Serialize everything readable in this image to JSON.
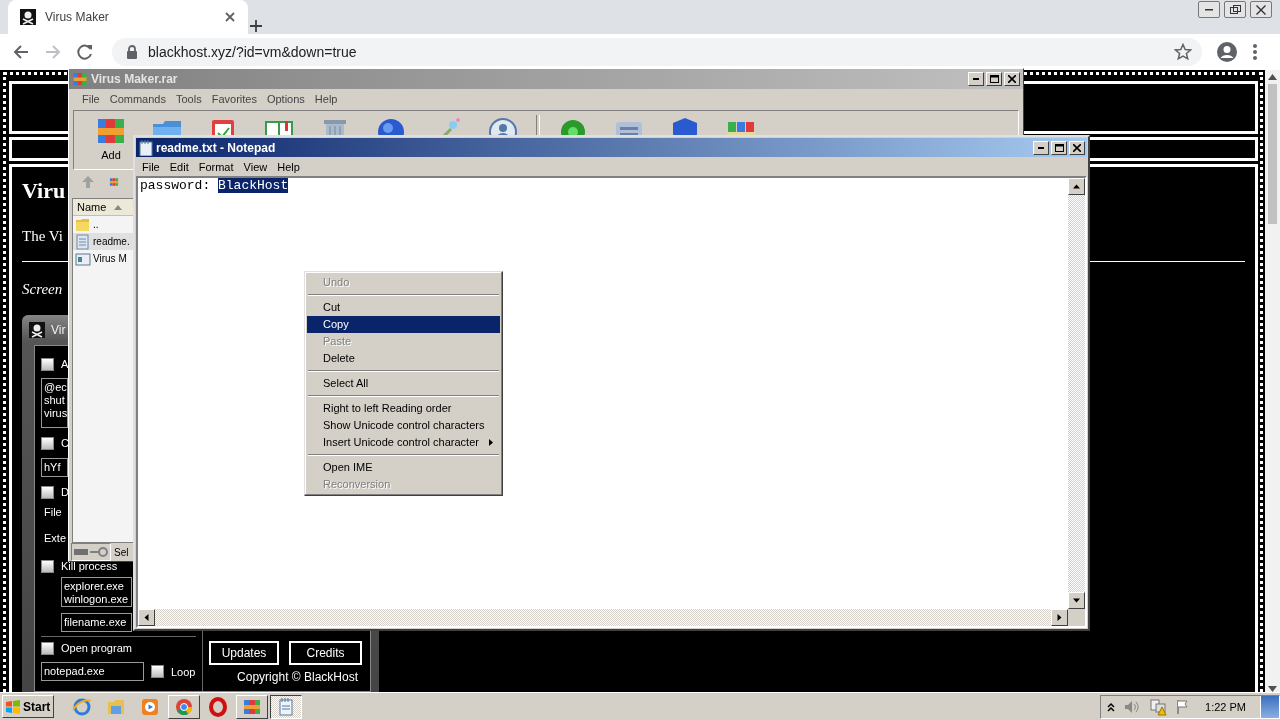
{
  "browser": {
    "tab": {
      "title": "Virus Maker",
      "selected": true
    },
    "address": "blackhost.xyz/?id=vm&down=true"
  },
  "page": {
    "heading": "Viru",
    "intro": "The Vi",
    "caption": "Screen",
    "app_preview": {
      "title": "Vir",
      "options": [
        {
          "kind": "checkbox",
          "label": "A",
          "checked": false
        },
        {
          "kind": "textarea",
          "lines": [
            "@ec",
            "shut",
            "virus"
          ],
          "indented": false
        },
        {
          "kind": "checkbox",
          "label": "C",
          "checked": false
        },
        {
          "kind": "field",
          "value": "hYf",
          "indented": false
        },
        {
          "kind": "checkbox",
          "label": "D",
          "checked": false
        },
        {
          "kind": "label",
          "text": "File"
        },
        {
          "kind": "label",
          "text": "Exte"
        },
        {
          "kind": "checkbox",
          "label": "Kill process",
          "checked": false
        },
        {
          "kind": "textarea",
          "lines": [
            "explorer.exe",
            "winlogon.exe"
          ],
          "indented": true
        },
        {
          "kind": "field",
          "value": "filename.exe",
          "indented": true
        },
        {
          "kind": "divider"
        },
        {
          "kind": "checkbox_with_field",
          "label": "Open program",
          "checked": false,
          "value": "notepad.exe",
          "loop": {
            "label": "Loop",
            "checked": false
          }
        }
      ],
      "buttons": [
        "Updates",
        "Credits"
      ],
      "copyright": "Copyright © BlackHost"
    }
  },
  "winrar": {
    "title": "Virus Maker.rar",
    "active": false,
    "menu": [
      "File",
      "Commands",
      "Tools",
      "Favorites",
      "Options",
      "Help"
    ],
    "toolbar": [
      {
        "kind": "books",
        "label": "Add"
      },
      {
        "kind": "folder"
      },
      {
        "kind": "clipboard"
      },
      {
        "kind": "book"
      },
      {
        "kind": "bin"
      },
      {
        "kind": "globe"
      },
      {
        "kind": "wand"
      },
      {
        "kind": "badge"
      },
      {
        "kind": "virus"
      },
      {
        "kind": "drawer"
      },
      {
        "kind": "shield"
      },
      {
        "kind": "jars"
      }
    ],
    "column": "Name",
    "files": [
      {
        "name": "..",
        "kind": "parent",
        "selected": false
      },
      {
        "name": "readme.",
        "kind": "text",
        "selected": true
      },
      {
        "name": "Virus M",
        "kind": "program",
        "selected": false
      }
    ],
    "status": "Sel"
  },
  "notepad": {
    "title": "readme.txt - Notepad",
    "active": true,
    "menu": [
      "File",
      "Edit",
      "Format",
      "View",
      "Help"
    ],
    "text": "password: ",
    "selection": "BlackHost"
  },
  "context_menu": {
    "groups": [
      [
        {
          "label": "Undo",
          "disabled": true,
          "selected": false,
          "submenu": false
        }
      ],
      [
        {
          "label": "Cut",
          "disabled": false,
          "selected": false,
          "submenu": false
        },
        {
          "label": "Copy",
          "disabled": false,
          "selected": true,
          "submenu": false
        },
        {
          "label": "Paste",
          "disabled": true,
          "selected": false,
          "submenu": false
        },
        {
          "label": "Delete",
          "disabled": false,
          "selected": false,
          "submenu": false
        }
      ],
      [
        {
          "label": "Select All",
          "disabled": false,
          "selected": false,
          "submenu": false
        }
      ],
      [
        {
          "label": "Right to left Reading order",
          "disabled": false,
          "selected": false,
          "submenu": false
        },
        {
          "label": "Show Unicode control characters",
          "disabled": false,
          "selected": false,
          "submenu": false
        },
        {
          "label": "Insert Unicode control character",
          "disabled": false,
          "selected": false,
          "submenu": true
        }
      ],
      [
        {
          "label": "Open IME",
          "disabled": false,
          "selected": false,
          "submenu": false
        },
        {
          "label": "Reconversion",
          "disabled": true,
          "selected": false,
          "submenu": false
        }
      ]
    ]
  },
  "taskbar": {
    "start": "Start",
    "apps": [
      {
        "kind": "ie",
        "running": false,
        "selected": false
      },
      {
        "kind": "folder",
        "running": false,
        "selected": false
      },
      {
        "kind": "media",
        "running": false,
        "selected": false
      },
      {
        "kind": "chrome",
        "running": true,
        "selected": false
      },
      {
        "kind": "opera",
        "running": false,
        "selected": false
      },
      {
        "kind": "winrar",
        "running": true,
        "selected": false
      },
      {
        "kind": "notepad",
        "running": true,
        "selected": true
      }
    ],
    "clock": "1:22 PM"
  }
}
